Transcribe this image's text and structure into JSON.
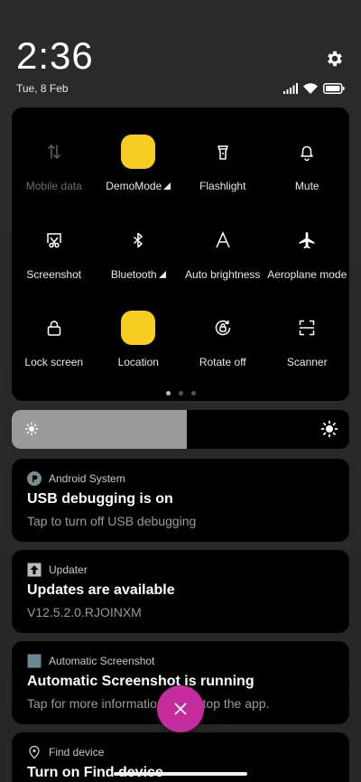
{
  "header": {
    "time": "2:36",
    "date": "Tue, 8 Feb"
  },
  "quick_settings": {
    "tiles": [
      {
        "label": "Mobile data",
        "icon": "mobile-data-icon",
        "state": "unavailable"
      },
      {
        "label": "DemoMode",
        "icon": "demo-mode-icon",
        "state": "on",
        "has_menu": true
      },
      {
        "label": "Flashlight",
        "icon": "flashlight-icon",
        "state": "off"
      },
      {
        "label": "Mute",
        "icon": "bell-icon",
        "state": "off"
      },
      {
        "label": "Screenshot",
        "icon": "screenshot-icon",
        "state": "off"
      },
      {
        "label": "Bluetooth",
        "icon": "bluetooth-icon",
        "state": "off",
        "has_menu": true
      },
      {
        "label": "Auto brightness",
        "icon": "auto-brightness-icon",
        "state": "off"
      },
      {
        "label": "Aeroplane mode",
        "icon": "airplane-icon",
        "state": "off"
      },
      {
        "label": "Lock screen",
        "icon": "lock-icon",
        "state": "off"
      },
      {
        "label": "Location",
        "icon": "location-icon",
        "state": "on"
      },
      {
        "label": "Rotate off",
        "icon": "rotate-icon",
        "state": "off"
      },
      {
        "label": "Scanner",
        "icon": "scanner-icon",
        "state": "off"
      }
    ],
    "page_count": 3,
    "current_page": 1
  },
  "brightness": {
    "level": 0.52
  },
  "notifications": [
    {
      "app": "Android System",
      "title": "USB debugging is on",
      "body": "Tap to turn off USB debugging"
    },
    {
      "app": "Updater",
      "title": "Updates are available",
      "body": "V12.5.2.0.RJOINXM"
    },
    {
      "app": "Automatic Screenshot",
      "title": "Automatic Screenshot is running",
      "body": "Tap for more information or to stop the app."
    },
    {
      "app": "Find device",
      "title": "Turn on Find device",
      "body": ""
    }
  ],
  "colors": {
    "tile_on": "#f7cd22",
    "fab": "#c42b9c",
    "panel": "#000000",
    "background": "#2a2a2a"
  }
}
